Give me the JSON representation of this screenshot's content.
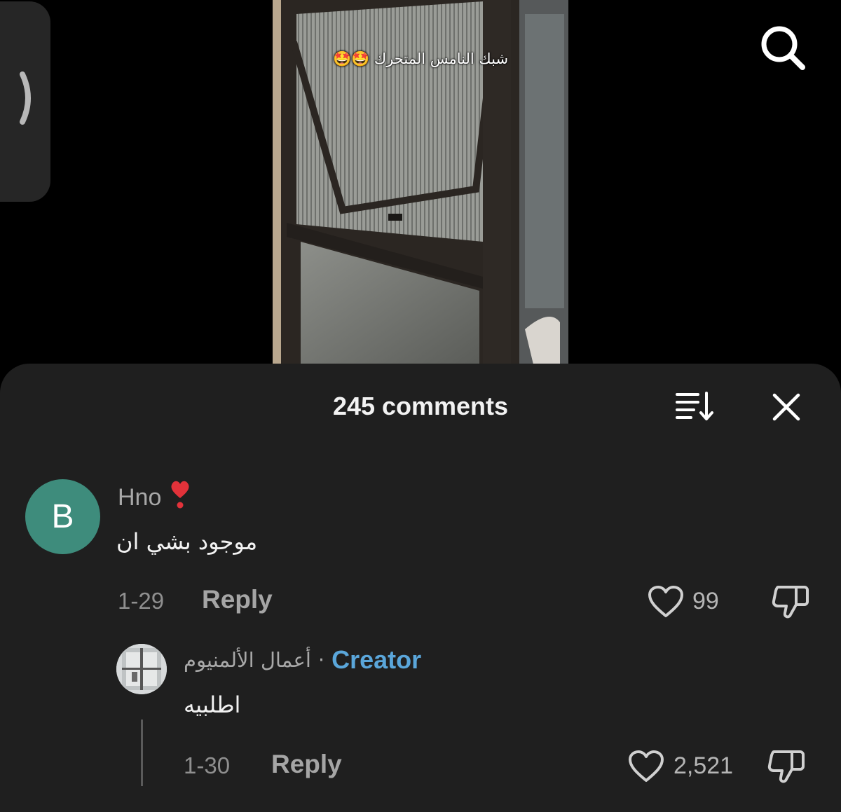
{
  "video": {
    "caption": "شبك النامس المتحرك 🤩🤩"
  },
  "icons": {
    "side_tab": "chevron-right-icon",
    "search": "search-icon",
    "sort": "sort-icon",
    "close": "close-icon",
    "like": "heart-outline-icon",
    "dislike": "thumbs-down-icon"
  },
  "comments_sheet": {
    "title": "245 comments",
    "comments": [
      {
        "avatar_letter": "B",
        "avatar_color": "#3e8c7c",
        "username": "Hno",
        "username_emoji": "❣️",
        "text": "موجود بشي ان",
        "date": "1-29",
        "reply_label": "Reply",
        "likes": "99"
      }
    ],
    "replies": [
      {
        "author": "أعمال الألمنيوم",
        "separator": "·",
        "badge": "Creator",
        "badge_color": "#5aa6da",
        "text": "اطلبيه",
        "date": "1-30",
        "reply_label": "Reply",
        "likes": "2,521"
      }
    ]
  }
}
